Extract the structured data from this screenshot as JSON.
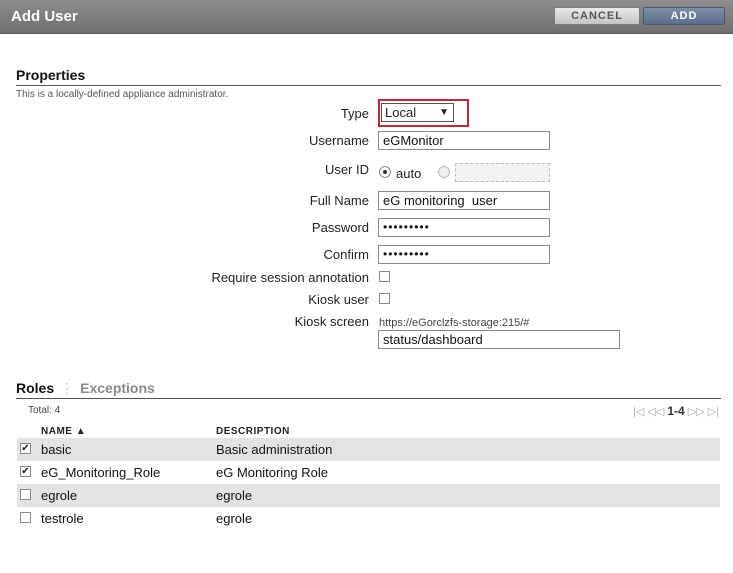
{
  "dialog": {
    "title": "Add User",
    "cancel_label": "CANCEL",
    "add_label": "ADD"
  },
  "properties": {
    "section_title": "Properties",
    "note": "This is a locally-defined appliance administrator.",
    "type_label": "Type",
    "type_value": "Local",
    "username_label": "Username",
    "username_value": "eGMonitor",
    "userid_label": "User ID",
    "userid_auto_label": "auto",
    "userid_mode": "auto",
    "fullname_label": "Full Name",
    "fullname_value": "eG monitoring  user",
    "password_label": "Password",
    "password_value": "•••••••••",
    "confirm_label": "Confirm",
    "confirm_value": "•••••••••",
    "require_annotation_label": "Require session annotation",
    "require_annotation_checked": false,
    "kiosk_user_label": "Kiosk user",
    "kiosk_user_checked": false,
    "kiosk_screen_label": "Kiosk screen",
    "kiosk_screen_url": "https://eGorclzfs-storage:215/#",
    "kiosk_screen_value": "status/dashboard"
  },
  "roles": {
    "tab_roles": "Roles",
    "tab_exceptions": "Exceptions",
    "total": "Total: 4",
    "pager_range": "1-4",
    "col_name": "NAME ▲",
    "col_description": "DESCRIPTION",
    "rows": [
      {
        "name": "basic",
        "description": "Basic administration",
        "checked": true
      },
      {
        "name": "eG_Monitoring_Role",
        "description": "eG Monitoring Role",
        "checked": true
      },
      {
        "name": "egrole",
        "description": "egrole",
        "checked": false
      },
      {
        "name": "testrole",
        "description": "egrole",
        "checked": false
      }
    ]
  },
  "colors": {
    "highlight": "#c0282d",
    "titlebar": "#7a7a7a",
    "add_button": "#5c6e89"
  }
}
